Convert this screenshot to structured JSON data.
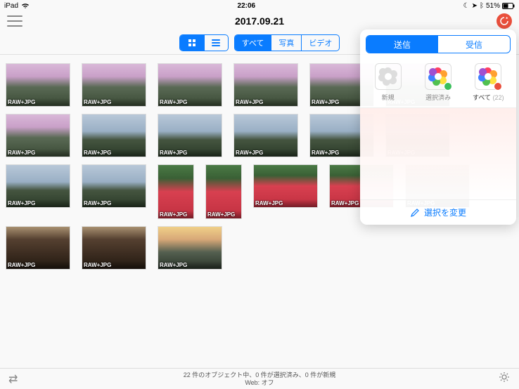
{
  "status": {
    "device": "iPad",
    "time": "22:06",
    "battery": "51%"
  },
  "nav": {
    "title": "2017.09.21"
  },
  "toolbar": {
    "filters": {
      "all": "すべて",
      "photo": "写真",
      "video": "ビデオ"
    }
  },
  "popover": {
    "tabs": {
      "send": "送信",
      "receive": "受信"
    },
    "options": {
      "new": "新規",
      "selected": "選択済み",
      "all_label": "すべて",
      "all_count": "(22)"
    },
    "change_selection": "選択を変更"
  },
  "badge": "RAW+JPG",
  "footer": {
    "line1": "22 件のオブジェクト中、0 件が選択済み、0 件が新規",
    "line2": "Web: オフ"
  },
  "thumbs": [
    {
      "cls": "wide sky"
    },
    {
      "cls": "wide sky"
    },
    {
      "cls": "wide sky"
    },
    {
      "cls": "wide sky"
    },
    {
      "cls": "wide sky"
    },
    {
      "cls": "wide sky"
    },
    {
      "cls": "wide sky"
    },
    {
      "cls": "wide cloudy"
    },
    {
      "cls": "wide cloudy"
    },
    {
      "cls": "wide cloudy"
    },
    {
      "cls": "wide cloudy"
    },
    {
      "cls": "wide cloudy"
    },
    {
      "cls": "wide cloudy"
    },
    {
      "cls": "wide cloudy"
    },
    {
      "cls": "tall flowers"
    },
    {
      "cls": "tall flowers"
    },
    {
      "cls": "wide flowers"
    },
    {
      "cls": "wide flowers"
    },
    {
      "cls": "wide machine"
    },
    {
      "cls": "wide machine"
    },
    {
      "cls": "wide machine"
    },
    {
      "cls": "wide dusk"
    }
  ]
}
